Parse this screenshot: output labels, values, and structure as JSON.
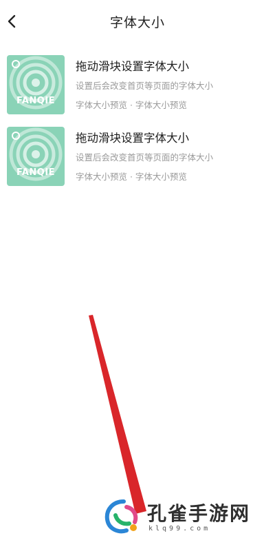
{
  "header": {
    "title": "字体大小",
    "back_icon": "chevron-left-icon"
  },
  "items": [
    {
      "thumb_brand": "FANQIE",
      "title": "拖动滑块设置字体大小",
      "description": "设置后会改变首页等页面的字体大小",
      "meta": "字体大小预览 · 字体大小预览"
    },
    {
      "thumb_brand": "FANQIE",
      "title": "拖动滑块设置字体大小",
      "description": "设置后会改变首页等页面的字体大小",
      "meta": "字体大小预览 · 字体大小预览"
    }
  ],
  "colors": {
    "thumb_background": "#8ad3b7",
    "annotation_arrow": "#d9262a"
  },
  "watermark": {
    "name": "孔雀手游网",
    "domain": "klq99.com"
  }
}
